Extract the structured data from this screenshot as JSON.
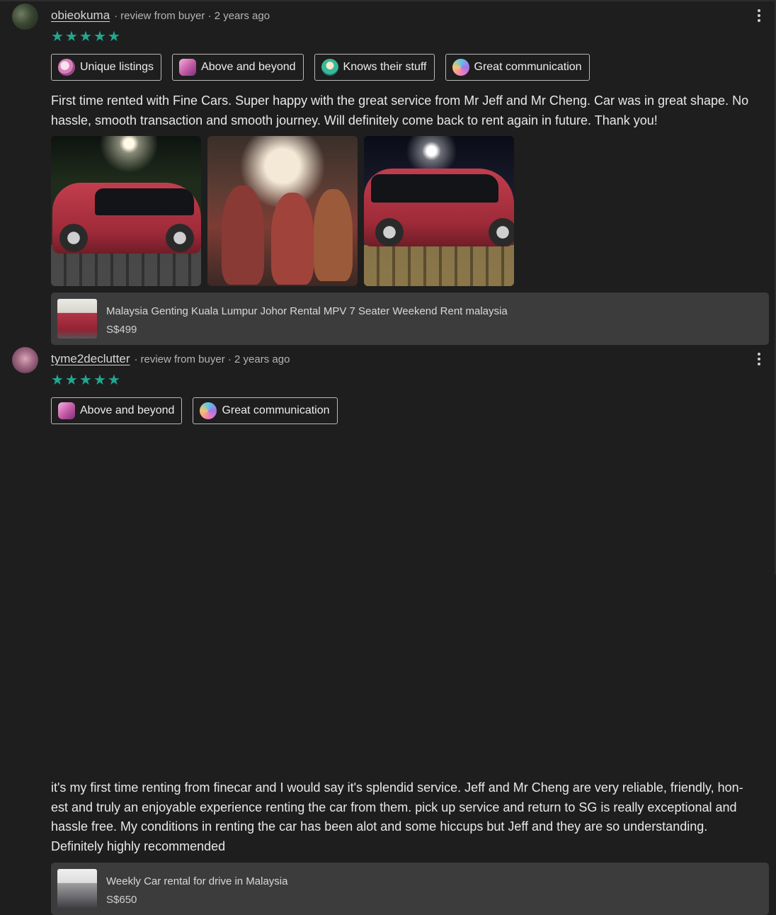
{
  "reviews": [
    {
      "username": "obieokuma",
      "meta": "review from buyer · 2 years ago",
      "rating": 5,
      "stars": "★★★★★",
      "tags": [
        {
          "label": "Unique listings",
          "icon": "magnifier-icon"
        },
        {
          "label": "Above and beyond",
          "icon": "above-beyond-icon"
        },
        {
          "label": "Knows their stuff",
          "icon": "lightbulb-icon"
        },
        {
          "label": "Great communication",
          "icon": "chat-bubble-icon"
        }
      ],
      "text": "First time rented with Fine Cars. Super happy with the great service from Mr Jeff and Mr Cheng. Car was in great shape. No hassle, smooth transaction and smooth journey. Will definitely come back to rent again in future. Thank you!",
      "photo_count": 3,
      "listing": {
        "title": "Malaysia Genting Kuala Lumpur Johor Rental MPV 7 Seater Weekend Rent malaysia",
        "price": "S$499"
      }
    },
    {
      "username": "tyme2declutter",
      "meta": "review from buyer · 2 years ago",
      "rating": 5,
      "stars": "★★★★★",
      "tags": [
        {
          "label": "Above and beyond",
          "icon": "above-beyond-icon"
        },
        {
          "label": "Great communication",
          "icon": "chat-bubble-icon"
        }
      ],
      "text": "it's my first time renting from finecar and I would say it's splendid service. Jeff and Mr Cheng are very reliable, friendly, hon-est and truly an enjoyable experience renting the car from them. pick up service and return to SG is really exceptional and hassle free. My conditions in renting the car has been alot and some hiccups but Jeff and they are so understanding. Definitely highly recommended",
      "listing": {
        "title": "Weekly Car rental for drive in Malaysia",
        "price": "S$650"
      }
    }
  ],
  "colors": {
    "background": "#1e1e1e",
    "star": "#21a88f",
    "listing_card": "#3c3c3c",
    "tag_border": "#b9b9b9"
  }
}
